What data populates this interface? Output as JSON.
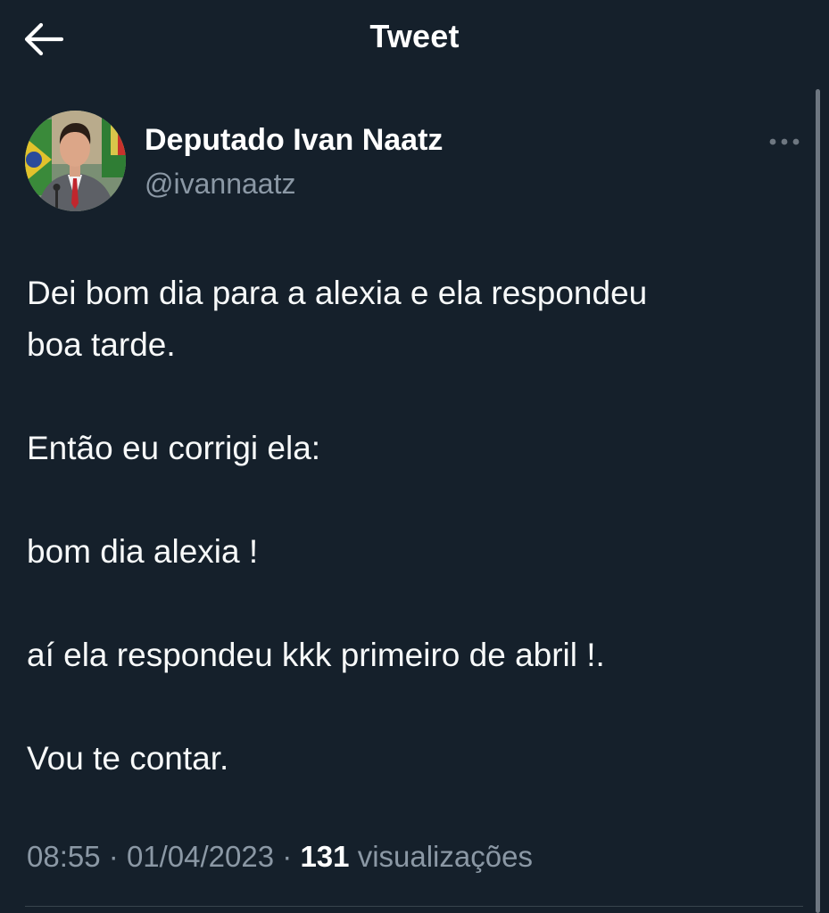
{
  "header": {
    "title": "Tweet",
    "back_icon": "arrow-left-icon"
  },
  "author": {
    "display_name": "Deputado Ivan Naatz",
    "handle": "@ivannaatz",
    "more_icon": "more-horizontal-icon"
  },
  "tweet": {
    "paragraphs": [
      [
        "Dei bom dia para a alexia e ela respondeu",
        "boa tarde."
      ],
      [
        "Então eu corrigi ela:"
      ],
      [
        "bom dia alexia !"
      ],
      [
        "aí ela respondeu kkk primeiro de abril !."
      ],
      [
        "Vou te contar."
      ]
    ]
  },
  "meta": {
    "time": "08:55",
    "separator": "·",
    "date": "01/04/2023",
    "views_count": "131",
    "views_label": "visualizações"
  },
  "colors": {
    "background": "#15202b",
    "text_primary": "#ffffff",
    "text_secondary": "#8b98a5",
    "divider": "#38444d"
  }
}
